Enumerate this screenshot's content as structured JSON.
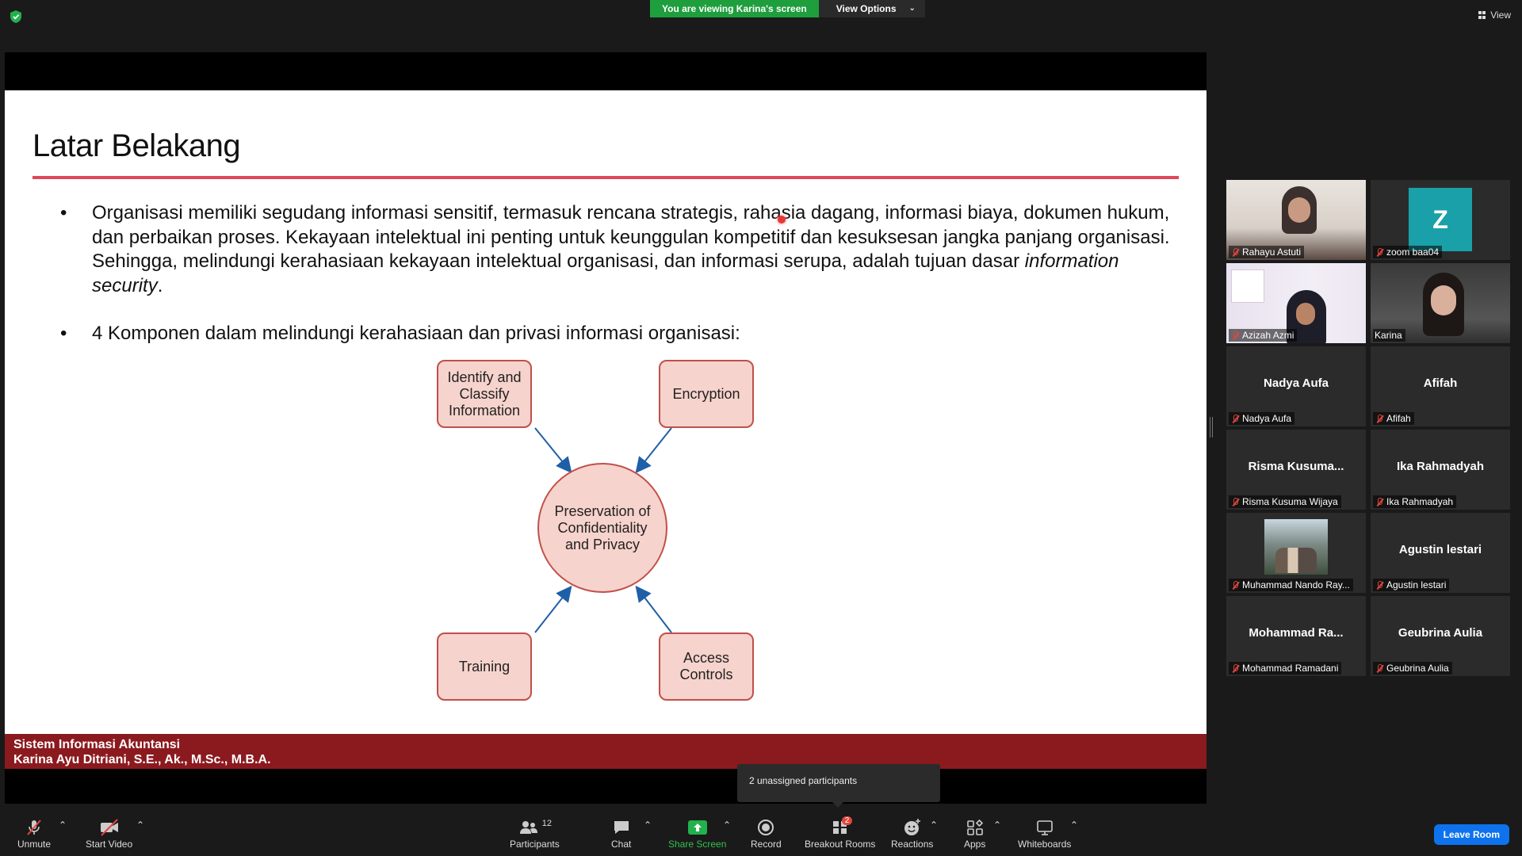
{
  "top": {
    "viewing_banner": "You are viewing Karina's screen",
    "view_options": "View Options",
    "view_label": "View"
  },
  "slide": {
    "title": "Latar Belakang",
    "bullet1_main": "Organisasi memiliki segudang informasi sensitif, termasuk rencana strategis, rahasia dagang, informasi biaya, dokumen hukum, dan perbaikan proses. Kekayaan intelektual ini penting untuk keunggulan kompetitif dan kesuksesan jangka panjang organisasi. Sehingga, melindungi kerahasiaan kekayaan intelektual organisasi, dan informasi serupa, adalah tujuan dasar ",
    "bullet1_italic": "information security",
    "bullet1_end": ".",
    "bullet2": "4 Komponen dalam melindungi kerahasiaan dan privasi informasi organisasi:",
    "bullet_char": "•",
    "diagram": {
      "top_left": "Identify and Classify Information",
      "top_right": "Encryption",
      "center": "Preservation of Confidentiality and Privacy",
      "bottom_left": "Training",
      "bottom_right": "Access Controls",
      "box_color": "#f6d3cc",
      "border_color": "#c0504a",
      "arrow_color": "#1f5fa8"
    },
    "footer_line1": "Sistem Informasi Akuntansi",
    "footer_line2": "Karina Ayu Ditriani, S.E., Ak., M.Sc., M.B.A."
  },
  "gallery": {
    "tiles": [
      {
        "label": "Rahayu Astuti",
        "name": ""
      },
      {
        "label": "zoom baa04",
        "name": "",
        "avatar_letter": "Z"
      },
      {
        "label": "Azizah Azmi",
        "name": ""
      },
      {
        "label": "Karina",
        "name": ""
      },
      {
        "label": "Nadya Aufa",
        "name": "Nadya Aufa"
      },
      {
        "label": "Afifah",
        "name": "Afifah"
      },
      {
        "label": "Risma Kusuma Wijaya",
        "name": "Risma  Kusuma..."
      },
      {
        "label": "Ika Rahmadyah",
        "name": "Ika Rahmadyah"
      },
      {
        "label": "Muhammad Nando Ray...",
        "name": ""
      },
      {
        "label": "Agustin lestari",
        "name": "Agustin lestari"
      },
      {
        "label": "Mohammad Ramadani",
        "name": "Mohammad  Ra..."
      },
      {
        "label": "Geubrina Aulia",
        "name": "Geubrina Aulia"
      }
    ]
  },
  "toolbar": {
    "unmute": "Unmute",
    "start_video": "Start Video",
    "participants": "Participants",
    "participants_count": "12",
    "chat": "Chat",
    "share_screen": "Share Screen",
    "record": "Record",
    "breakout_rooms": "Breakout Rooms",
    "breakout_badge": "2",
    "reactions": "Reactions",
    "apps": "Apps",
    "whiteboards": "Whiteboards",
    "leave_room": "Leave Room",
    "caret": "⌃"
  },
  "tooltip": {
    "unassigned": "2 unassigned participants"
  },
  "colors": {
    "share_green": "#1f9e3e",
    "leave_blue": "#0e72ed",
    "footer_red": "#8b1a1f",
    "title_rule": "#e0485a"
  }
}
